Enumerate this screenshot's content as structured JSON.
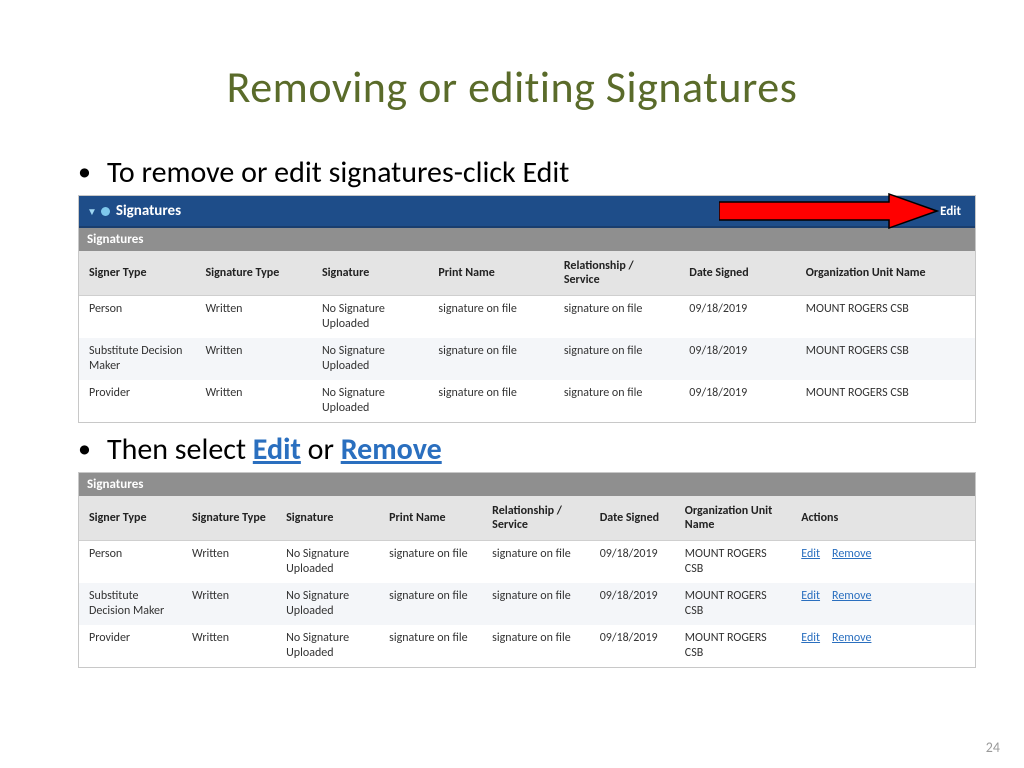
{
  "slide": {
    "title": "Removing or editing Signatures",
    "bullet1": "To remove or edit signatures-click Edit",
    "bullet2_prefix": "Then select ",
    "bullet2_kw1": "Edit",
    "bullet2_mid": " or ",
    "bullet2_kw2": "Remove",
    "page_number": "24"
  },
  "panel1": {
    "section_title": "Signatures",
    "sub_title": "Signatures",
    "edit_label": "Edit",
    "headers": [
      "Signer Type",
      "Signature Type",
      "Signature",
      "Print Name",
      "Relationship / Service",
      "Date Signed",
      "Organization Unit Name"
    ],
    "rows": [
      {
        "signer": "Person",
        "sigtype": "Written",
        "signature": "No Signature Uploaded",
        "print": "signature on file",
        "rel": "signature on file",
        "date": "09/18/2019",
        "org": "MOUNT ROGERS CSB"
      },
      {
        "signer": "Substitute Decision Maker",
        "sigtype": "Written",
        "signature": "No Signature Uploaded",
        "print": "signature on file",
        "rel": "signature on file",
        "date": "09/18/2019",
        "org": "MOUNT ROGERS CSB"
      },
      {
        "signer": "Provider",
        "sigtype": "Written",
        "signature": "No Signature Uploaded",
        "print": "signature on file",
        "rel": "signature on file",
        "date": "09/18/2019",
        "org": "MOUNT ROGERS CSB"
      }
    ]
  },
  "panel2": {
    "sub_title": "Signatures",
    "headers": [
      "Signer Type",
      "Signature Type",
      "Signature",
      "Print Name",
      "Relationship / Service",
      "Date Signed",
      "Organization Unit Name",
      "Actions"
    ],
    "action_edit": "Edit",
    "action_remove": "Remove",
    "rows": [
      {
        "signer": "Person",
        "sigtype": "Written",
        "signature": "No Signature Uploaded",
        "print": "signature on file",
        "rel": "signature on file",
        "date": "09/18/2019",
        "org": "MOUNT ROGERS CSB"
      },
      {
        "signer": "Substitute Decision Maker",
        "sigtype": "Written",
        "signature": "No Signature Uploaded",
        "print": "signature on file",
        "rel": "signature on file",
        "date": "09/18/2019",
        "org": "MOUNT ROGERS CSB"
      },
      {
        "signer": "Provider",
        "sigtype": "Written",
        "signature": "No Signature Uploaded",
        "print": "signature on file",
        "rel": "signature on file",
        "date": "09/18/2019",
        "org": "MOUNT ROGERS CSB"
      }
    ]
  }
}
